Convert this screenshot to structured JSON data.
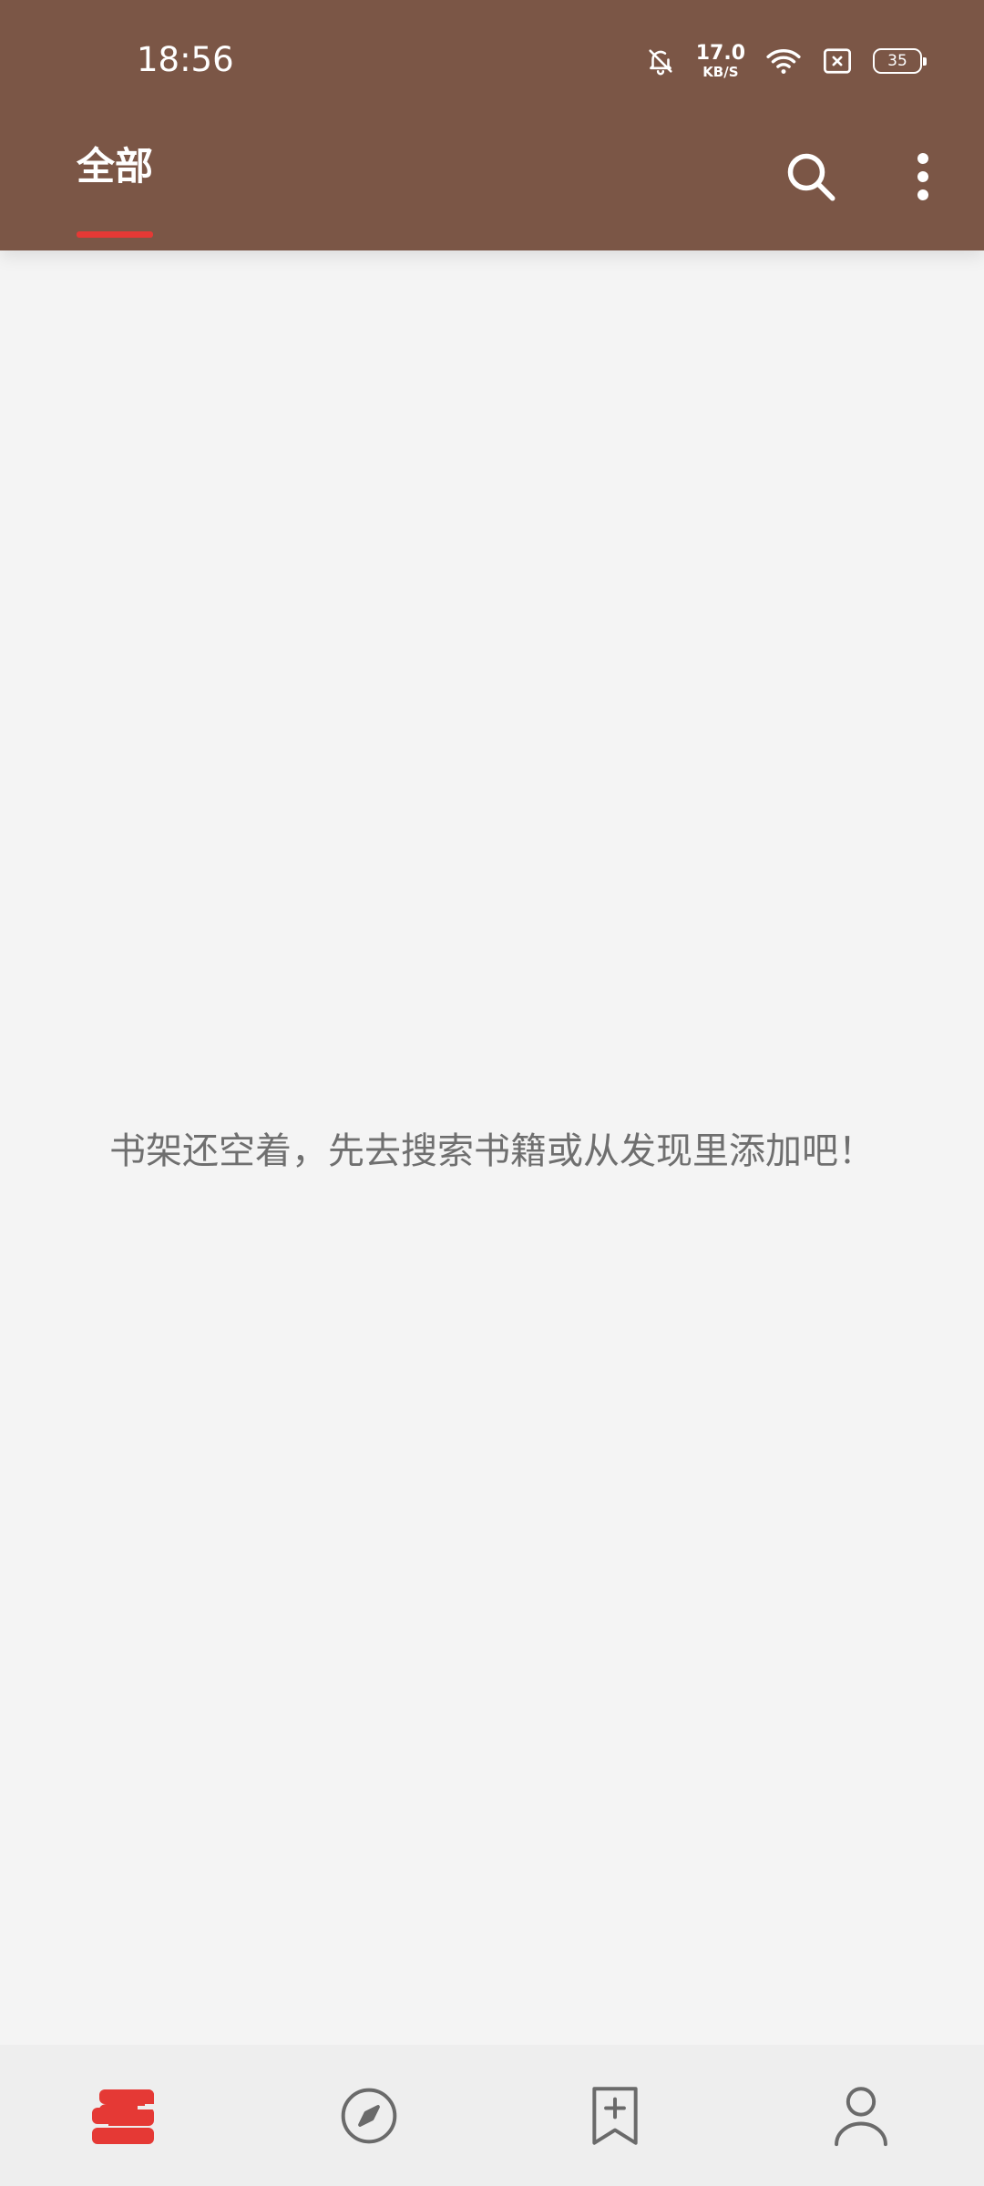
{
  "status_bar": {
    "time": "18:56",
    "net_speed_value": "17.0",
    "net_speed_unit": "KB/S",
    "battery_level": "35",
    "icons": [
      "bell-muted-icon",
      "wifi-icon",
      "sim-disabled-icon",
      "battery-icon"
    ]
  },
  "toolbar": {
    "tab_label": "全部",
    "actions": [
      "search-icon",
      "more-vert-icon"
    ]
  },
  "empty_state": {
    "message": "书架还空着，先去搜索书籍或从发现里添加吧！"
  },
  "bottom_nav": {
    "items": [
      {
        "icon": "bookshelf-icon",
        "active": true
      },
      {
        "icon": "compass-icon",
        "active": false
      },
      {
        "icon": "bookmark-add-icon",
        "active": false
      },
      {
        "icon": "person-icon",
        "active": false
      }
    ]
  },
  "colors": {
    "header_bg": "#7b5646",
    "accent": "#e53935",
    "page_bg": "#f4f4f4",
    "nav_bg": "#eeeeee",
    "icon_inactive": "#6a6a6a",
    "message_text": "#6f6f6f"
  }
}
